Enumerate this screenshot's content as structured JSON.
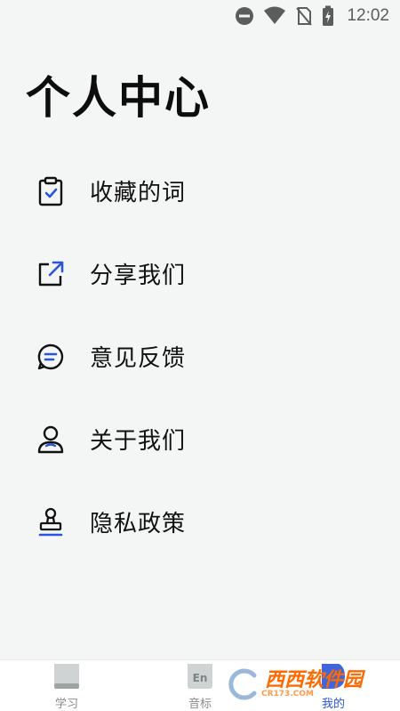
{
  "status_bar": {
    "time": "12:02",
    "icons": [
      "do-not-disturb-icon",
      "wifi-icon",
      "no-sim-icon",
      "battery-charging-icon"
    ]
  },
  "page": {
    "title": "个人中心"
  },
  "menu": {
    "items": [
      {
        "label": "收藏的词",
        "icon": "clipboard-check-icon"
      },
      {
        "label": "分享我们",
        "icon": "share-icon"
      },
      {
        "label": "意见反馈",
        "icon": "chat-bubble-icon"
      },
      {
        "label": "关于我们",
        "icon": "person-icon"
      },
      {
        "label": "隐私政策",
        "icon": "stamp-icon"
      }
    ]
  },
  "tabbar": {
    "tabs": [
      {
        "label": "学习",
        "icon": "book-icon",
        "active": false
      },
      {
        "label": "音标",
        "icon": "en-card-icon",
        "active": false
      },
      {
        "label": "我的",
        "icon": "profile-icon",
        "active": true
      }
    ]
  },
  "watermark": {
    "text": "西西软件园",
    "sub": "CR173.COM"
  },
  "colors": {
    "accent": "#2b55d8",
    "background": "#f4f5f5",
    "text": "#111111"
  }
}
